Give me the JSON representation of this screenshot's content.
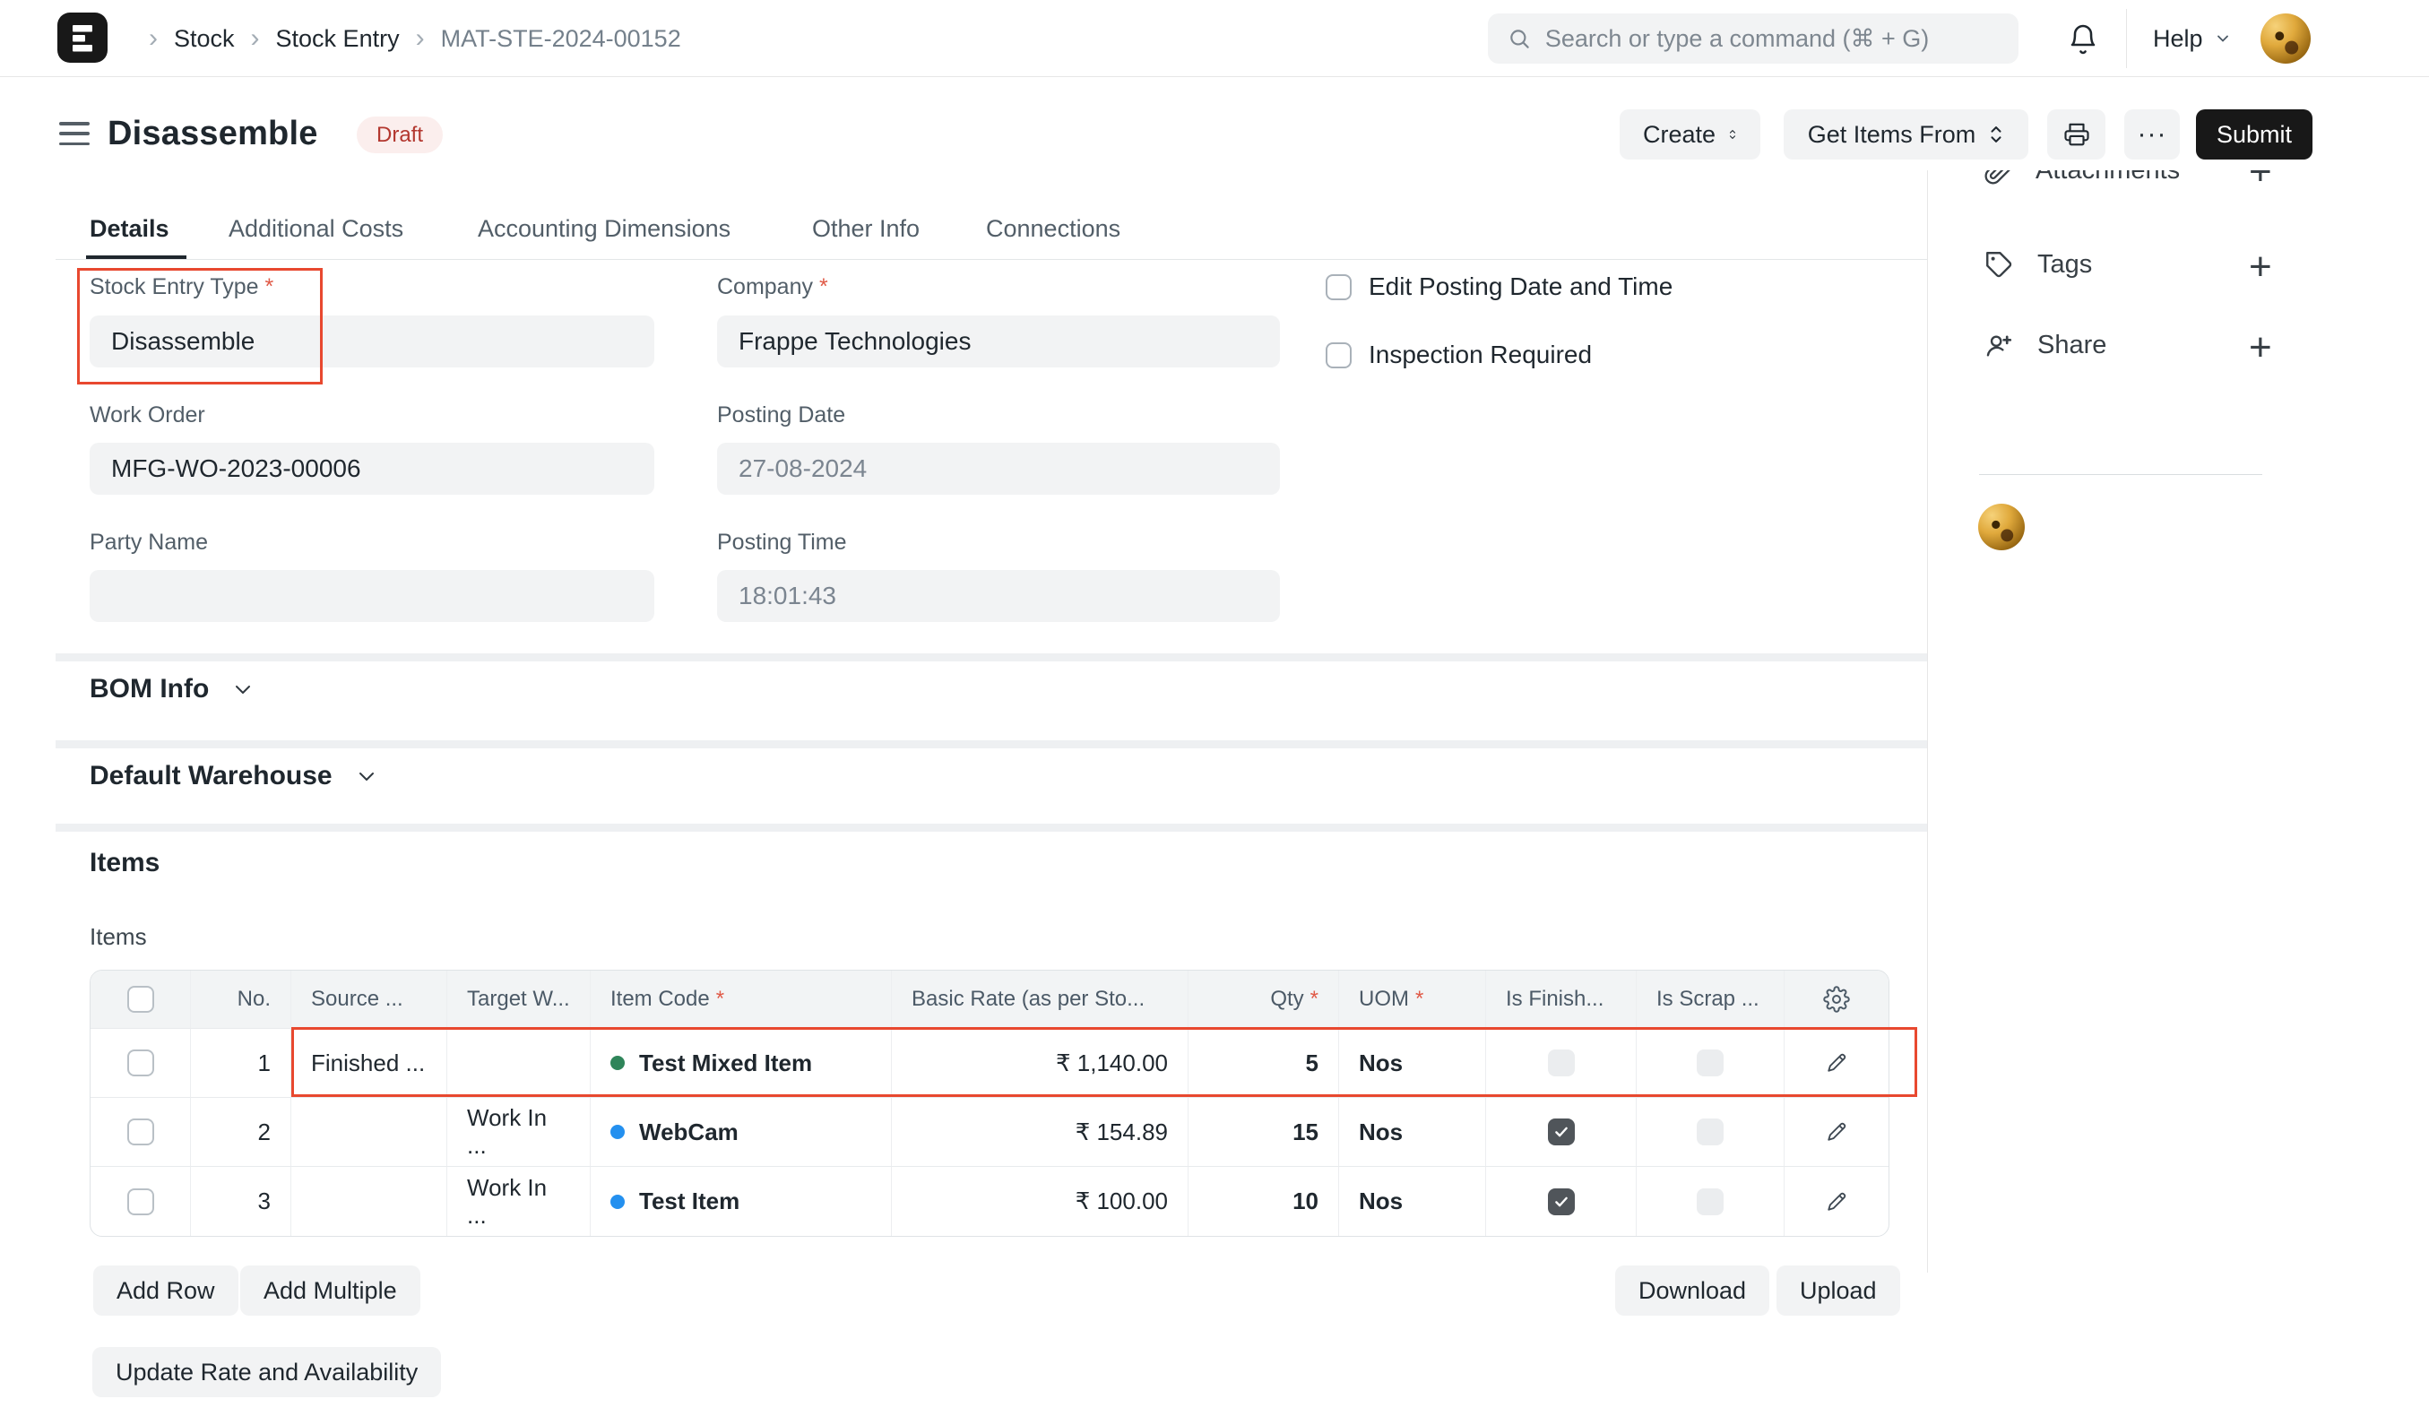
{
  "ui": {
    "required_mark": "*"
  },
  "icons": {
    "breadcrumb_chevron": "›",
    "ellipsis": "···",
    "plus": "+",
    "gear": "⚙"
  },
  "colors": {
    "annotation": "#e8482f",
    "status_green": "#2f855a",
    "status_blue": "#2490ef",
    "draft_bg": "#fbeeed",
    "draft_text": "#b3372f"
  },
  "navbar": {
    "breadcrumb": [
      "Stock",
      "Stock Entry",
      "MAT-STE-2024-00152"
    ],
    "search_placeholder": "Search or type a command (⌘ + G)",
    "help": "Help"
  },
  "header": {
    "title": "Disassemble",
    "status": "Draft",
    "create": "Create",
    "get_items_from": "Get Items From",
    "submit": "Submit"
  },
  "tabs": [
    {
      "label": "Details"
    },
    {
      "label": "Additional Costs"
    },
    {
      "label": "Accounting Dimensions"
    },
    {
      "label": "Other Info"
    },
    {
      "label": "Connections"
    }
  ],
  "form": {
    "stock_entry_type": {
      "label": "Stock Entry Type",
      "value": "Disassemble",
      "required": true
    },
    "company": {
      "label": "Company",
      "value": "Frappe Technologies",
      "required": true
    },
    "work_order": {
      "label": "Work Order",
      "value": "MFG-WO-2023-00006"
    },
    "posting_date": {
      "label": "Posting Date",
      "value": "27-08-2024"
    },
    "party_name": {
      "label": "Party Name",
      "value": ""
    },
    "posting_time": {
      "label": "Posting Time",
      "value": "18:01:43"
    },
    "edit_posting": {
      "label": "Edit Posting Date and Time",
      "checked": false
    },
    "inspection_required": {
      "label": "Inspection Required",
      "checked": false
    }
  },
  "sections": {
    "bom_info": "BOM Info",
    "default_warehouse": "Default Warehouse"
  },
  "items": {
    "section_title": "Items",
    "field_label": "Items",
    "columns": {
      "no": "No.",
      "source": "Source ...",
      "target": "Target W...",
      "item_code": "Item Code",
      "basic_rate": "Basic Rate (as per Sto...",
      "qty": "Qty",
      "uom": "UOM",
      "is_finished": "Is Finish...",
      "is_scrap": "Is Scrap ..."
    },
    "rows": [
      {
        "no": "1",
        "source": "Finished ...",
        "target": "",
        "item_code": "Test Mixed Item",
        "dot": "green",
        "rate": "₹ 1,140.00",
        "qty": "5",
        "uom": "Nos",
        "is_finished": false,
        "is_scrap": false
      },
      {
        "no": "2",
        "source": "",
        "target": "Work In ...",
        "item_code": "WebCam",
        "dot": "blue",
        "rate": "₹ 154.89",
        "qty": "15",
        "uom": "Nos",
        "is_finished": true,
        "is_scrap": false
      },
      {
        "no": "3",
        "source": "",
        "target": "Work In ...",
        "item_code": "Test Item",
        "dot": "blue",
        "rate": "₹ 100.00",
        "qty": "10",
        "uom": "Nos",
        "is_finished": true,
        "is_scrap": false
      }
    ],
    "buttons": {
      "add_row": "Add Row",
      "add_multiple": "Add Multiple",
      "download": "Download",
      "upload": "Upload",
      "update_rate": "Update Rate and Availability"
    }
  },
  "sidebar": {
    "attachments": "Attachments",
    "tags": "Tags",
    "share": "Share"
  },
  "annotations": {
    "highlight_color": "#e8482f",
    "highlighted": [
      "Stock Entry Type field",
      "Items table row 1"
    ]
  }
}
